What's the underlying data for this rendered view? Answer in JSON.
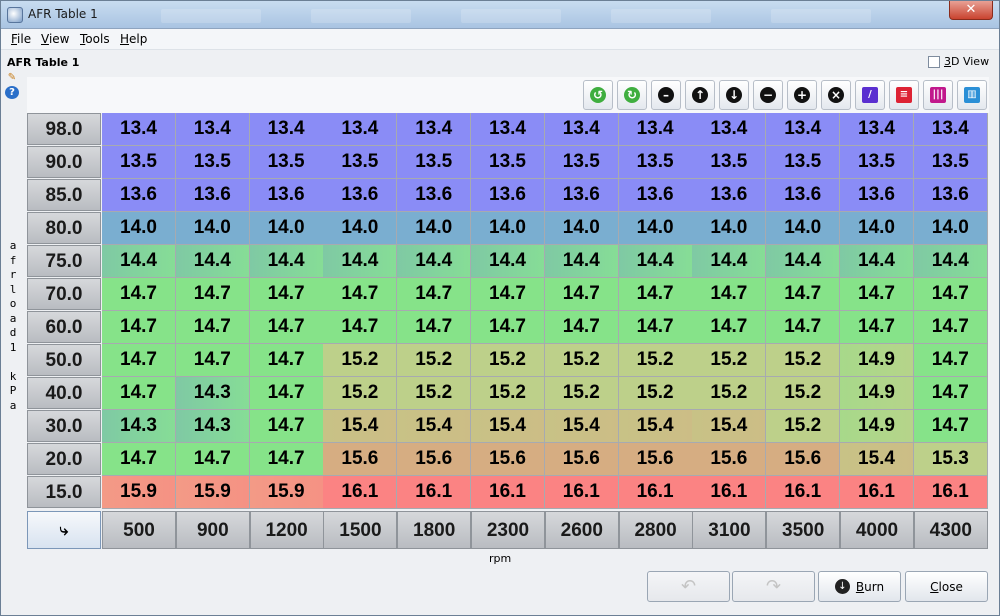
{
  "window": {
    "title": "AFR Table 1"
  },
  "menu": [
    {
      "key": "F",
      "rest": "ile"
    },
    {
      "key": "V",
      "rest": "iew"
    },
    {
      "key": "T",
      "rest": "ools"
    },
    {
      "key": "H",
      "rest": "elp"
    }
  ],
  "panel": {
    "title": "AFR Table 1",
    "view3d_key": "3",
    "view3d_rest": "D View",
    "view3d_checked": false
  },
  "toolbar": {
    "icons": [
      "rotate-left-icon",
      "rotate-right-icon",
      "flatten-icon",
      "shift-up-icon",
      "shift-down-icon",
      "decrease-icon",
      "increase-icon",
      "clear-icon",
      "interpolate-icon",
      "interpolate-vertical-icon",
      "interpolate-horizontal-icon",
      "color-scale-icon"
    ]
  },
  "table": {
    "y_axis_label": "afrload1 kPa",
    "x_axis_label": "rpm",
    "row_labels": [
      "98.0",
      "90.0",
      "85.0",
      "80.0",
      "75.0",
      "70.0",
      "60.0",
      "50.0",
      "40.0",
      "30.0",
      "20.0",
      "15.0"
    ],
    "col_labels": [
      "500",
      "900",
      "1200",
      "1500",
      "1800",
      "2300",
      "2600",
      "2800",
      "3100",
      "3500",
      "4000",
      "4300"
    ],
    "values": [
      [
        "13.4",
        "13.4",
        "13.4",
        "13.4",
        "13.4",
        "13.4",
        "13.4",
        "13.4",
        "13.4",
        "13.4",
        "13.4",
        "13.4"
      ],
      [
        "13.5",
        "13.5",
        "13.5",
        "13.5",
        "13.5",
        "13.5",
        "13.5",
        "13.5",
        "13.5",
        "13.5",
        "13.5",
        "13.5"
      ],
      [
        "13.6",
        "13.6",
        "13.6",
        "13.6",
        "13.6",
        "13.6",
        "13.6",
        "13.6",
        "13.6",
        "13.6",
        "13.6",
        "13.6"
      ],
      [
        "14.0",
        "14.0",
        "14.0",
        "14.0",
        "14.0",
        "14.0",
        "14.0",
        "14.0",
        "14.0",
        "14.0",
        "14.0",
        "14.0"
      ],
      [
        "14.4",
        "14.4",
        "14.4",
        "14.4",
        "14.4",
        "14.4",
        "14.4",
        "14.4",
        "14.4",
        "14.4",
        "14.4",
        "14.4"
      ],
      [
        "14.7",
        "14.7",
        "14.7",
        "14.7",
        "14.7",
        "14.7",
        "14.7",
        "14.7",
        "14.7",
        "14.7",
        "14.7",
        "14.7"
      ],
      [
        "14.7",
        "14.7",
        "14.7",
        "14.7",
        "14.7",
        "14.7",
        "14.7",
        "14.7",
        "14.7",
        "14.7",
        "14.7",
        "14.7"
      ],
      [
        "14.7",
        "14.7",
        "14.7",
        "15.2",
        "15.2",
        "15.2",
        "15.2",
        "15.2",
        "15.2",
        "15.2",
        "14.9",
        "14.7"
      ],
      [
        "14.7",
        "14.3",
        "14.7",
        "15.2",
        "15.2",
        "15.2",
        "15.2",
        "15.2",
        "15.2",
        "15.2",
        "14.9",
        "14.7"
      ],
      [
        "14.3",
        "14.3",
        "14.7",
        "15.4",
        "15.4",
        "15.4",
        "15.4",
        "15.4",
        "15.4",
        "15.2",
        "14.9",
        "14.7"
      ],
      [
        "14.7",
        "14.7",
        "14.7",
        "15.6",
        "15.6",
        "15.6",
        "15.6",
        "15.6",
        "15.6",
        "15.6",
        "15.4",
        "15.3"
      ],
      [
        "15.9",
        "15.9",
        "15.9",
        "16.1",
        "16.1",
        "16.1",
        "16.1",
        "16.1",
        "16.1",
        "16.1",
        "16.1",
        "16.1"
      ]
    ]
  },
  "buttons": {
    "undo_icon": "undo-icon",
    "redo_icon": "redo-icon",
    "burn_key": "B",
    "burn_rest": "urn",
    "close_key": "C",
    "close_rest": "lose"
  },
  "colors": {
    "blue": "#8a8cf6",
    "steel": "#7aaed0",
    "green": "#86e389",
    "olive": "#bdd08a",
    "tan": "#d6ad82",
    "red": "#fb8383"
  }
}
